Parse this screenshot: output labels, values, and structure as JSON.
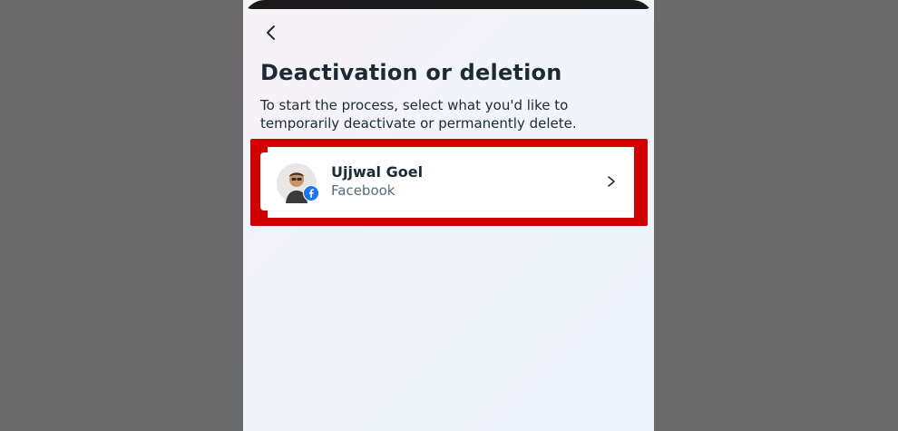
{
  "header": {
    "back_icon": "chevron-left-icon"
  },
  "page": {
    "title": "Deactivation or deletion",
    "description": "To start the process, select what you'd like to temporarily deactivate or permanently delete."
  },
  "account": {
    "name": "Ujjwal Goel",
    "platform": "Facebook",
    "avatar_icon": "user-avatar-icon",
    "badge_icon": "facebook-icon",
    "chevron_icon": "chevron-right-icon"
  },
  "colors": {
    "background_outside": "#6a6a6a",
    "highlight_border": "#d10000",
    "title_text": "#1c2b33",
    "secondary_text": "#5c6b74",
    "facebook_blue": "#1877f2"
  }
}
